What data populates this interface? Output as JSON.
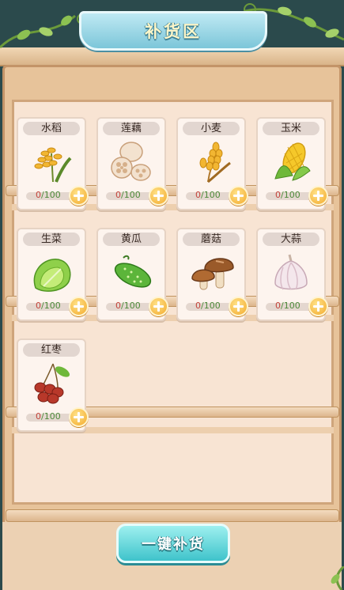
{
  "header": {
    "title": "补货区"
  },
  "items": [
    {
      "name": "水稻",
      "current": "0",
      "max": "/100",
      "icon": "rice-icon"
    },
    {
      "name": "莲藕",
      "current": "0",
      "max": "/100",
      "icon": "lotus-root-icon"
    },
    {
      "name": "小麦",
      "current": "0",
      "max": "/100",
      "icon": "wheat-icon"
    },
    {
      "name": "玉米",
      "current": "0",
      "max": "/100",
      "icon": "corn-icon"
    },
    {
      "name": "生菜",
      "current": "0",
      "max": "/100",
      "icon": "lettuce-icon"
    },
    {
      "name": "黄瓜",
      "current": "0",
      "max": "/100",
      "icon": "cucumber-icon"
    },
    {
      "name": "蘑菇",
      "current": "0",
      "max": "/100",
      "icon": "mushroom-icon"
    },
    {
      "name": "大蒜",
      "current": "0",
      "max": "/100",
      "icon": "garlic-icon"
    },
    {
      "name": "红枣",
      "current": "0",
      "max": "/100",
      "icon": "red-date-icon"
    }
  ],
  "footer": {
    "restock_all_label": "一键补货"
  }
}
